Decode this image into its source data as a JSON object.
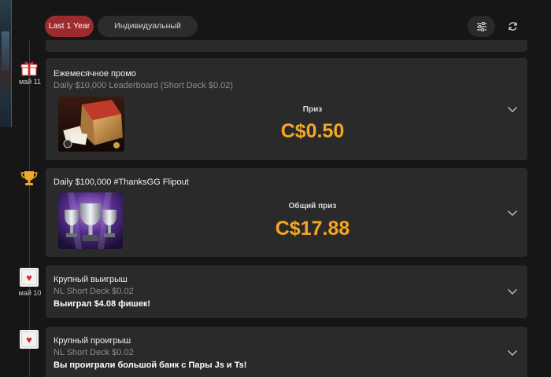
{
  "toolbar": {
    "year_label": "Last 1 Year",
    "range_label": "Индивидуальный диапазон",
    "filter_icon": "sliders-icon",
    "refresh_icon": "refresh-icon"
  },
  "timeline": {
    "dates": [
      "май 11",
      "май 10"
    ]
  },
  "cards": [
    {
      "icon": "gift-icon",
      "title": "Ежемесячное промо",
      "subtitle": "Daily $10,000 Leaderboard (Short Deck $0.02)",
      "prize_label": "Приз",
      "prize_value": "C$0.50"
    },
    {
      "icon": "trophy-icon",
      "title": "Daily $100,000 #ThanksGG Flipout",
      "prize_label": "Общий приз",
      "prize_value": "C$17.88"
    },
    {
      "icon": "playing-card-heart-icon",
      "title": "Крупный выигрыш",
      "subtitle": "NL Short Deck $0.02",
      "detail": "Выиграл $4.08 фишек!"
    },
    {
      "icon": "playing-card-heart-icon",
      "title": "Крупный проигрыш",
      "subtitle": "NL Short Deck $0.02",
      "detail": "Вы проиграли большой банк с Пары Js и Ts!"
    }
  ],
  "colors": {
    "accent_red": "#9d2a2f",
    "prize_gold": "#f5a623",
    "card_bg": "#2a2a2b",
    "page_bg": "#161616"
  }
}
